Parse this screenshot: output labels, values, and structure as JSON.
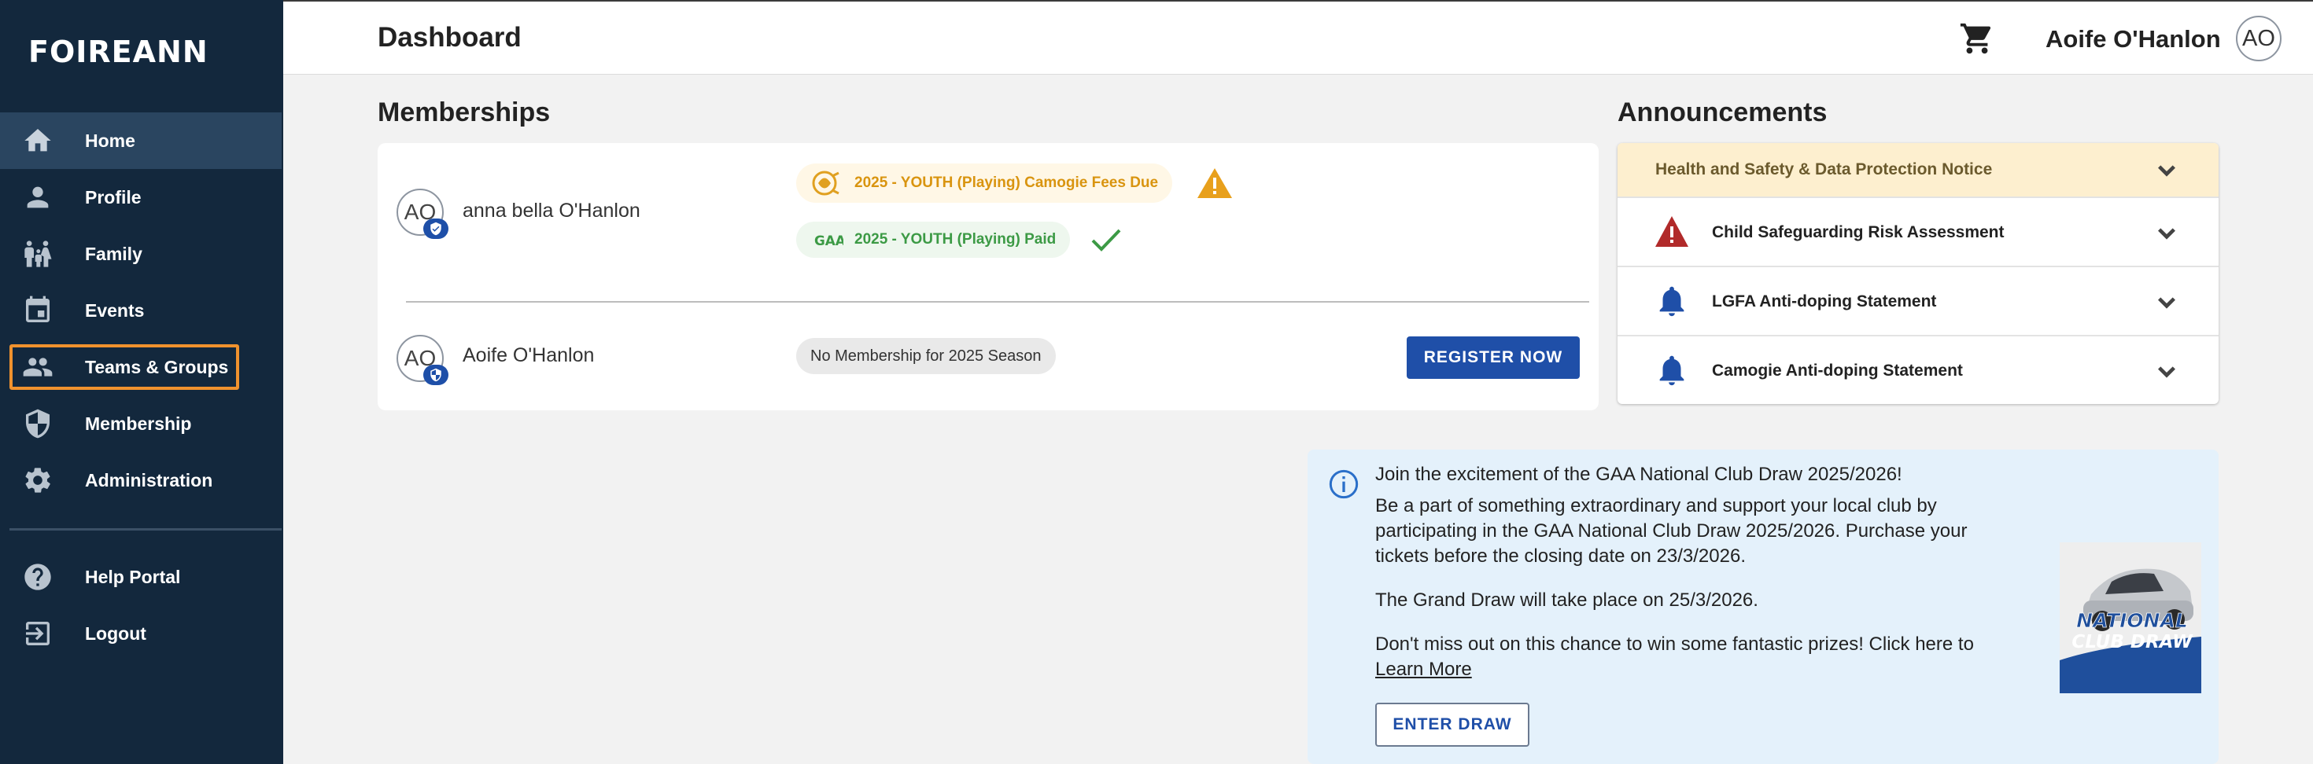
{
  "app": {
    "logo_text": "FOIREANN"
  },
  "sidebar": {
    "items": [
      {
        "label": "Home",
        "icon": "home-icon",
        "active": true
      },
      {
        "label": "Profile",
        "icon": "person-icon"
      },
      {
        "label": "Family",
        "icon": "family-icon"
      },
      {
        "label": "Events",
        "icon": "calendar-icon"
      },
      {
        "label": "Teams & Groups",
        "icon": "group-icon",
        "highlighted": true
      },
      {
        "label": "Membership",
        "icon": "shield-icon"
      },
      {
        "label": "Administration",
        "icon": "gear-icon"
      }
    ],
    "footer_items": [
      {
        "label": "Help Portal",
        "icon": "help-icon"
      },
      {
        "label": "Logout",
        "icon": "logout-icon"
      }
    ]
  },
  "header": {
    "title": "Dashboard",
    "user_name": "Aoife O'Hanlon",
    "user_initials": "AO"
  },
  "memberships": {
    "title": "Memberships",
    "members": [
      {
        "initials": "AO",
        "name": "anna bella O'Hanlon",
        "statuses": [
          {
            "text": "2025 - YOUTH (Playing) Camogie Fees Due",
            "state": "due"
          },
          {
            "text": "2025 - YOUTH (Playing) Paid",
            "state": "paid"
          }
        ]
      },
      {
        "initials": "AO",
        "name": "Aoife O'Hanlon",
        "statuses": [
          {
            "text": "No Membership for 2025 Season",
            "state": "none"
          }
        ],
        "action_label": "REGISTER NOW"
      }
    ]
  },
  "announcements": {
    "title": "Announcements",
    "items": [
      {
        "title": "Health and Safety & Data Protection Notice",
        "icon": ""
      },
      {
        "title": "Child Safeguarding Risk Assessment",
        "icon": "warning-icon"
      },
      {
        "title": "LGFA Anti-doping Statement",
        "icon": "bell-icon"
      },
      {
        "title": "Camogie Anti-doping Statement",
        "icon": "bell-icon"
      }
    ]
  },
  "draw": {
    "heading": "Join the excitement of the GAA National Club Draw 2025/2026!",
    "body1": "Be a part of something extraordinary and support your local club by participating in the GAA National Club Draw 2025/2026. Purchase your tickets before the closing date on 23/3/2026.",
    "body2": "The Grand Draw will take place on 25/3/2026.",
    "body3": "Don't miss out on this chance to win some fantastic prizes! Click here to",
    "link_text": "Learn More",
    "button_label": "ENTER DRAW",
    "image_text_1": "NATIONAL",
    "image_text_2": "CLUB DRAW"
  },
  "colors": {
    "sidebar_bg": "#13283d",
    "accent_blue": "#1f4fa8",
    "due_orange": "#d9940f",
    "paid_green": "#3c9a45",
    "highlight_orange": "#f0922e"
  }
}
